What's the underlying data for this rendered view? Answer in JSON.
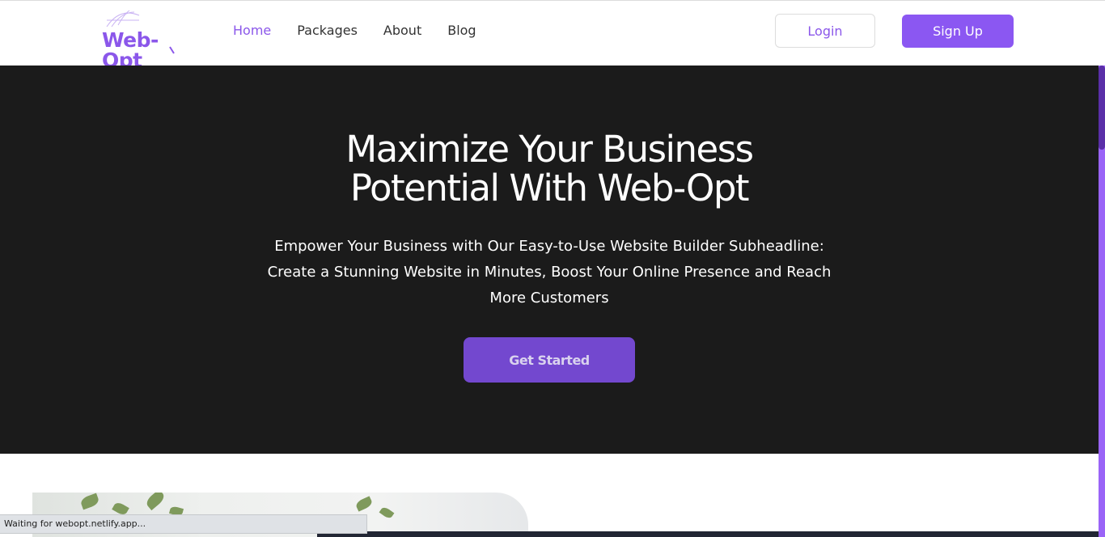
{
  "header": {
    "logo_text": "Web-Opt",
    "nav": [
      {
        "label": "Home",
        "active": true
      },
      {
        "label": "Packages",
        "active": false
      },
      {
        "label": "About",
        "active": false
      },
      {
        "label": "Blog",
        "active": false
      }
    ],
    "login_label": "Login",
    "signup_label": "Sign Up"
  },
  "hero": {
    "title_line1": "Maximize Your Business",
    "title_line2": "Potential With Web-Opt",
    "subtitle": "Empower Your Business with Our Easy-to-Use Website Builder Subheadline: Create a Stunning Website in Minutes, Boost Your Online Presence and Reach More Customers",
    "cta_label": "Get Started"
  },
  "status_bar": {
    "text": "Waiting for webopt.netlify.app..."
  },
  "colors": {
    "accent": "#8b57f2",
    "hero_bg": "#1b1b1b",
    "cta_bg": "#7348cf"
  }
}
